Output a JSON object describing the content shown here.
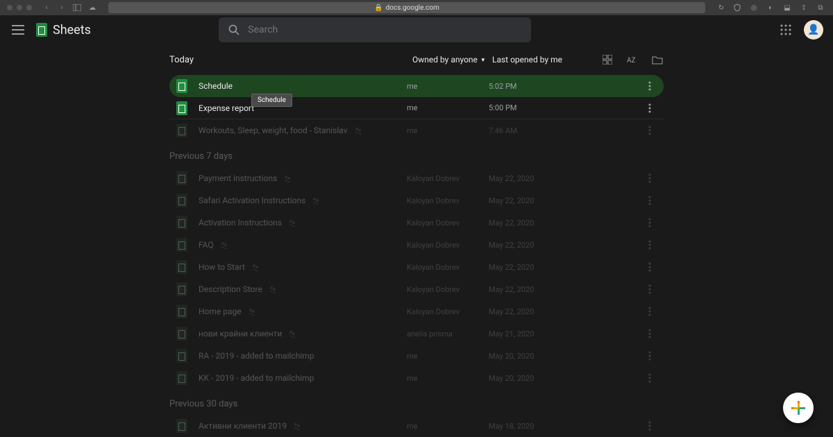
{
  "browser": {
    "url": "docs.google.com"
  },
  "header": {
    "app_name": "Sheets",
    "search_placeholder": "Search"
  },
  "filters": {
    "owner_label": "Owned by anyone",
    "sort_label": "Last opened by me"
  },
  "tooltip": "Schedule",
  "sections": [
    {
      "label": "Today",
      "files": [
        {
          "name": "Schedule",
          "owner": "me",
          "date": "5:02 PM",
          "highlighted": true,
          "shared": false
        },
        {
          "name": "Expense report",
          "owner": "me",
          "date": "5:00 PM",
          "highlighted": false,
          "shared": false
        },
        {
          "name": "Workouts, Sleep, weight, food - Stanislav",
          "owner": "me",
          "date": "7:46 AM",
          "dimmed": true,
          "shared": true
        }
      ]
    },
    {
      "label": "Previous 7 days",
      "dimmed": true,
      "files": [
        {
          "name": "Payment instructions",
          "owner": "Kaloyan Dobrev",
          "date": "May 22, 2020",
          "dimmed": true,
          "shared": true
        },
        {
          "name": "Safari Activation Instructions",
          "owner": "Kaloyan Dobrev",
          "date": "May 22, 2020",
          "dimmed": true,
          "shared": true
        },
        {
          "name": "Activation Instructions",
          "owner": "Kaloyan Dobrev",
          "date": "May 22, 2020",
          "dimmed": true,
          "shared": true
        },
        {
          "name": "FAQ",
          "owner": "Kaloyan Dobrev",
          "date": "May 22, 2020",
          "dimmed": true,
          "shared": true
        },
        {
          "name": "How to Start",
          "owner": "Kaloyan Dobrev",
          "date": "May 22, 2020",
          "dimmed": true,
          "shared": true
        },
        {
          "name": "Description Store",
          "owner": "Kaloyan Dobrev",
          "date": "May 22, 2020",
          "dimmed": true,
          "shared": true
        },
        {
          "name": "Home page",
          "owner": "Kaloyan Dobrev",
          "date": "May 22, 2020",
          "dimmed": true,
          "shared": true
        },
        {
          "name": "нови крайни клиенти",
          "owner": "anelia prisma",
          "date": "May 21, 2020",
          "dimmed": true,
          "shared": true
        },
        {
          "name": "RA - 2019 - added to mailchimp",
          "owner": "me",
          "date": "May 20, 2020",
          "dimmed": true,
          "shared": false
        },
        {
          "name": "KK - 2019 - added to mailchimp",
          "owner": "me",
          "date": "May 20, 2020",
          "dimmed": true,
          "shared": false
        }
      ]
    },
    {
      "label": "Previous 30 days",
      "dimmed": true,
      "files": [
        {
          "name": "Активни клиенти 2019",
          "owner": "me",
          "date": "May 18, 2020",
          "dimmed": true,
          "shared": true
        }
      ]
    }
  ]
}
